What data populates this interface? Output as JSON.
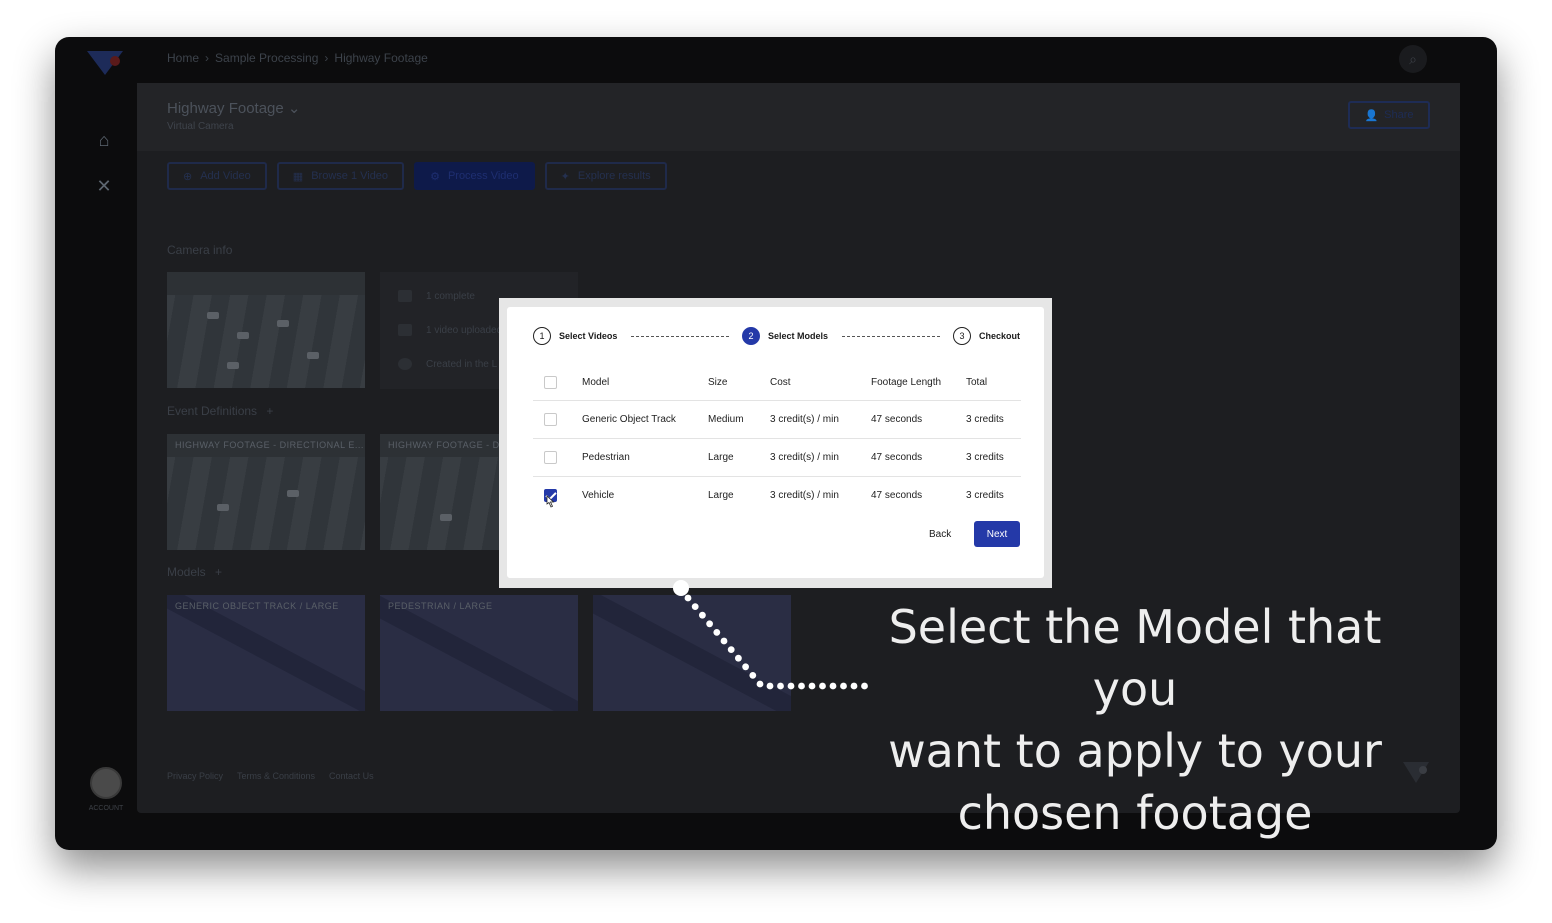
{
  "breadcrumb": [
    "Home",
    "Sample Processing",
    "Highway Footage"
  ],
  "project": {
    "title": "Highway Footage",
    "subtitle": "Virtual Camera"
  },
  "share_label": "Share",
  "actions": [
    {
      "label": "Add Video",
      "icon": "plus-circle-icon"
    },
    {
      "label": "Browse 1 Video",
      "icon": "grid-icon"
    },
    {
      "label": "Process Video",
      "icon": "gear-icon"
    },
    {
      "label": "Explore results",
      "icon": "sparkle-icon"
    }
  ],
  "sections": {
    "camera_info": "Camera info",
    "event_definitions": "Event Definitions",
    "models": "Models",
    "add_symbol": "+"
  },
  "camera_info_rows": [
    "1 complete",
    "1 video uploaded",
    "Created in the L"
  ],
  "event_thumbs": [
    "HIGHWAY FOOTAGE - DIRECTIONAL E...",
    "HIGHWAY FOOTAGE - DIRE"
  ],
  "model_thumbs": [
    "GENERIC OBJECT TRACK / LARGE",
    "PEDESTRIAN / LARGE",
    ""
  ],
  "footer_links": [
    "Privacy Policy",
    "Terms & Conditions",
    "Contact Us"
  ],
  "avatar_label": "ACCOUNT",
  "modal": {
    "steps": [
      {
        "num": "1",
        "label": "Select Videos",
        "active": false
      },
      {
        "num": "2",
        "label": "Select Models",
        "active": true
      },
      {
        "num": "3",
        "label": "Checkout",
        "active": false
      }
    ],
    "columns": [
      "Model",
      "Size",
      "Cost",
      "Footage Length",
      "Total"
    ],
    "rows": [
      {
        "model": "Generic Object Track",
        "size": "Medium",
        "cost": "3 credit(s) / min",
        "length": "47 seconds",
        "total": "3 credits",
        "checked": false
      },
      {
        "model": "Pedestrian",
        "size": "Large",
        "cost": "3 credit(s) / min",
        "length": "47 seconds",
        "total": "3 credits",
        "checked": false
      },
      {
        "model": "Vehicle",
        "size": "Large",
        "cost": "3 credit(s) / min",
        "length": "47 seconds",
        "total": "3 credits",
        "checked": true
      }
    ],
    "back_label": "Back",
    "next_label": "Next"
  },
  "callout": {
    "line1": "Select the Model that you",
    "line2": "want to apply to your",
    "line3": "chosen footage"
  },
  "colors": {
    "accent": "#2439a8",
    "frame": "#0c0c0d",
    "modal_bg": "#ffffff",
    "callout_text": "#eeeeee"
  }
}
